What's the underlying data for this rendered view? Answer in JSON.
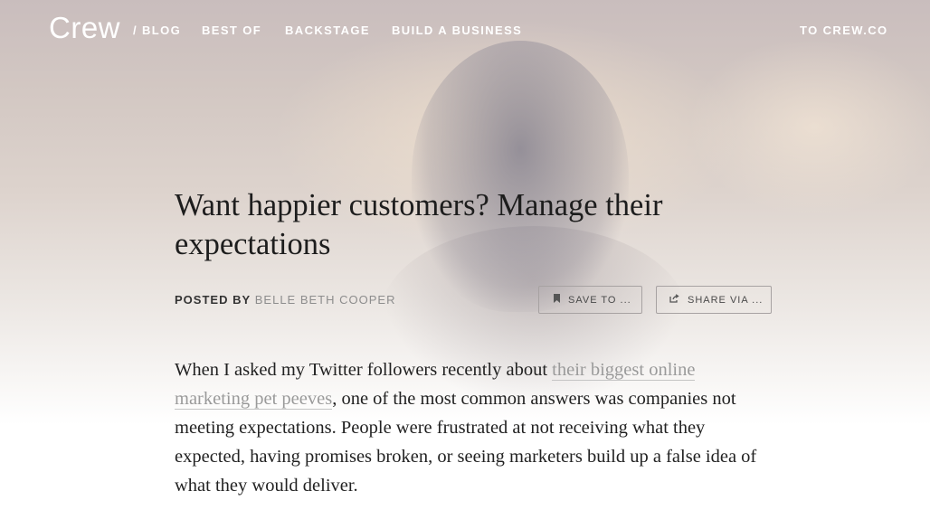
{
  "nav": {
    "logo": "Crew",
    "blog": "/ BLOG",
    "items": [
      "BEST OF",
      "BACKSTAGE",
      "BUILD A BUSINESS"
    ],
    "external": "TO CREW.CO"
  },
  "article": {
    "title": "Want happier customers? Manage their expectations",
    "posted_by": "POSTED BY",
    "author": "BELLE BETH COOPER",
    "save_label": "SAVE TO ...",
    "share_label": "SHARE VIA ...",
    "para_before": "When I asked my Twitter followers recently about ",
    "para_link": "their biggest online marketing pet peeves",
    "para_after": ", one of the most common answers was companies not meeting expectations. People were frustrated at not receiving what they expected, having promises broken, or seeing marketers build up a false idea of what they would deliver."
  },
  "icons": {
    "save": "bookmark-icon",
    "share": "share-icon"
  }
}
